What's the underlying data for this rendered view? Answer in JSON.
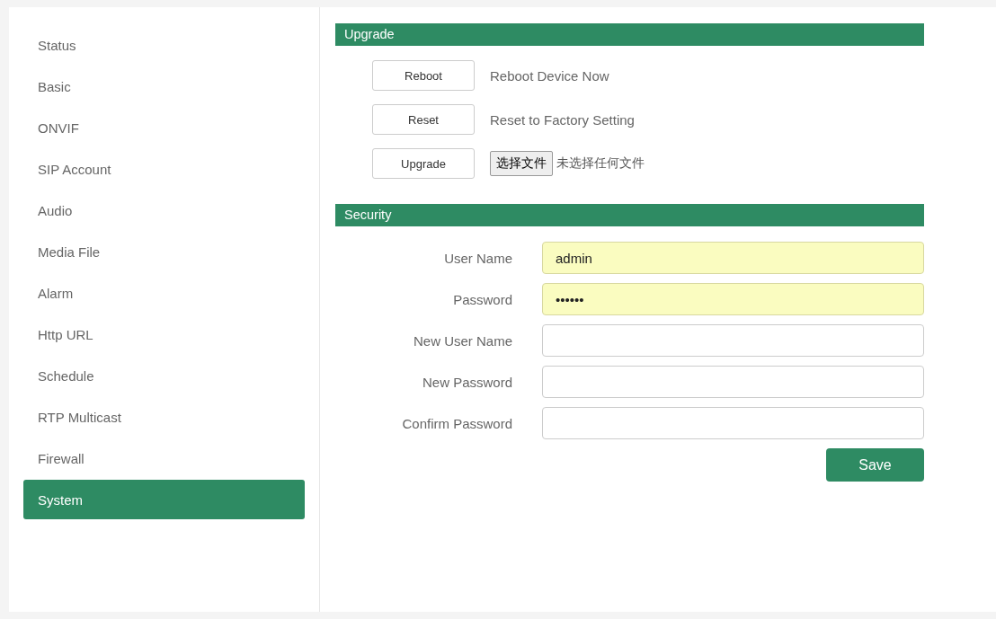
{
  "sidebar": {
    "items": [
      {
        "label": "Status",
        "selected": false
      },
      {
        "label": "Basic",
        "selected": false
      },
      {
        "label": "ONVIF",
        "selected": false
      },
      {
        "label": "SIP Account",
        "selected": false
      },
      {
        "label": "Audio",
        "selected": false
      },
      {
        "label": "Media File",
        "selected": false
      },
      {
        "label": "Alarm",
        "selected": false
      },
      {
        "label": "Http URL",
        "selected": false
      },
      {
        "label": "Schedule",
        "selected": false
      },
      {
        "label": "RTP Multicast",
        "selected": false
      },
      {
        "label": "Firewall",
        "selected": false
      },
      {
        "label": "System",
        "selected": true
      }
    ]
  },
  "upgrade": {
    "title": "Upgrade",
    "rows": [
      {
        "kind": "action",
        "button": "Reboot",
        "description": "Reboot Device Now"
      },
      {
        "kind": "action",
        "button": "Reset",
        "description": "Reset to Factory Setting"
      },
      {
        "kind": "file",
        "button": "Upgrade",
        "file_button": "选择文件",
        "file_status": "未选择任何文件"
      }
    ]
  },
  "security": {
    "title": "Security",
    "fields": [
      {
        "label": "User Name",
        "value": "admin",
        "autofilled": true
      },
      {
        "label": "Password",
        "value": "••••••",
        "autofilled": true
      },
      {
        "label": "New User Name",
        "autofilled": false
      },
      {
        "label": "New Password",
        "autofilled": false
      },
      {
        "label": "Confirm Password",
        "autofilled": false
      }
    ],
    "save_button": "Save"
  }
}
